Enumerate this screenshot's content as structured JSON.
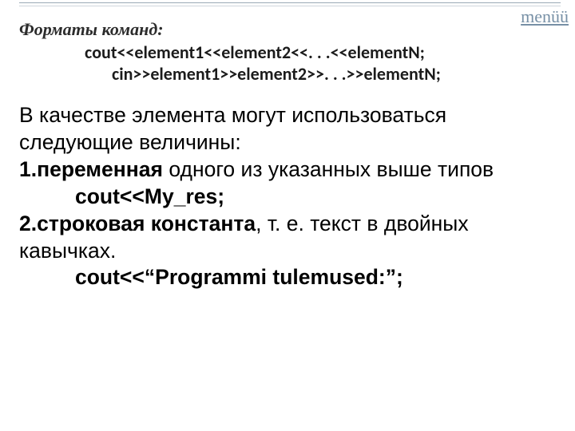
{
  "menu": {
    "label": "menüü"
  },
  "header": {
    "caption": "Форматы команд:",
    "cout_line": "cоut<<element1<<element2<<. . .<<elementN;",
    "cin_line": "cin>>element1>>element2>>. . .>>elementN;"
  },
  "body": {
    "intro1": "В качестве элемента могут использоваться",
    "intro2": "следующие величины:",
    "item1_prefix": "1.",
    "item1_bold": "переменная",
    "item1_tail": "   одного   из   указанных   выше  типов",
    "item1_example": "cout<<My_res;",
    "item2_prefix": "2.",
    "item2_bold": "строковая константа",
    "item2_mid": ", т. е. текст в двойных ",
    "item2_end": "кавычках.",
    "item2_example": "cout<<“Programmi tulemused:”;"
  }
}
